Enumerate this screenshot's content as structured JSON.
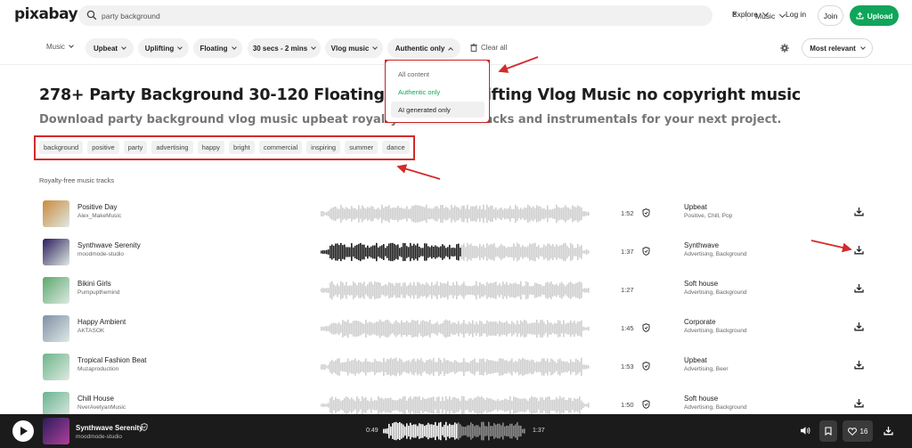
{
  "header": {
    "logo": "pixabay",
    "search": {
      "value": "party background",
      "clear": "×",
      "type_label": "Music"
    },
    "explore": "Explore",
    "login": "Log in",
    "join": "Join",
    "upload": "Upload"
  },
  "filters": {
    "music": "Music",
    "pills": [
      "Upbeat",
      "Uplifting",
      "Floating",
      "30 secs - 2 mins",
      "Vlog music",
      "Authentic only"
    ],
    "clear_all": "Clear all",
    "sort": "Most relevant"
  },
  "dropdown": {
    "items": [
      "All content",
      "Authentic only",
      "AI generated only"
    ]
  },
  "page": {
    "title": "278+ Party Background 30-120 Floating Upbeat Uplifting Vlog Music no copyright music",
    "subtitle": "Download party background vlog music upbeat royalty-free audio tracks and instrumentals for your next project.",
    "tags": [
      "background",
      "positive",
      "party",
      "advertising",
      "happy",
      "bright",
      "commercial",
      "inspiring",
      "summer",
      "dance"
    ],
    "section_label": "Royalty-free music tracks"
  },
  "tracks": [
    {
      "title": "Positive Day",
      "artist": "Alex_MakeMusic",
      "duration": "1:52",
      "genre": "Upbeat",
      "tags": "Positive, Chill, Pop",
      "thumb_color": "#c98a3d",
      "progress": 0
    },
    {
      "title": "Synthwave Serenity",
      "artist": "moodmode-studio",
      "duration": "1:37",
      "genre": "Synthwave",
      "tags": "Advertising, Background",
      "thumb_color": "#2b1d5c",
      "progress": 0.52
    },
    {
      "title": "Bikini Girls",
      "artist": "Pumpupthemind",
      "duration": "1:27",
      "genre": "Soft house",
      "tags": "Advertising, Background",
      "thumb_color": "#5aa86d",
      "progress": 0
    },
    {
      "title": "Happy Ambient",
      "artist": "AKTASOK",
      "duration": "1:45",
      "genre": "Corporate",
      "tags": "Advertising, Background",
      "thumb_color": "#7f8fa8",
      "progress": 0
    },
    {
      "title": "Tropical Fashion Beat",
      "artist": "Muzaproduction",
      "duration": "1:53",
      "genre": "Upbeat",
      "tags": "Advertising, Beer",
      "thumb_color": "#6cb58a",
      "progress": 0
    },
    {
      "title": "Chill House",
      "artist": "NverAvetyanMusic",
      "duration": "1:50",
      "genre": "Soft house",
      "tags": "Advertising, Background",
      "thumb_color": "#68b391",
      "progress": 0
    }
  ],
  "player": {
    "title": "Synthwave Serenity",
    "artist": "moodmode-studio",
    "current": "0:49",
    "total": "1:37",
    "likes": "16",
    "progress": 0.52
  },
  "colors": {
    "accent": "#10a55b",
    "annotation": "#d42a2a",
    "player_bg": "#1b1b1b"
  }
}
